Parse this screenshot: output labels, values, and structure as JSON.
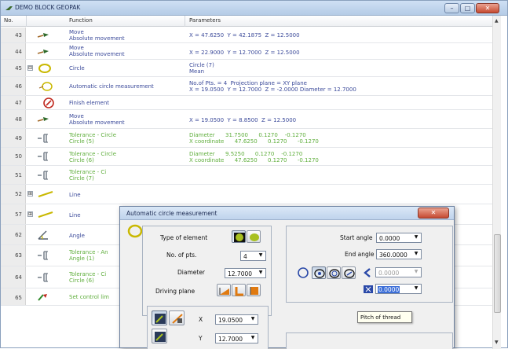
{
  "window": {
    "title": "DEMO BLOCK GEOPAK"
  },
  "columns": {
    "no": "No.",
    "function": "Function",
    "parameters": "Parameters"
  },
  "rows": [
    {
      "no": "43",
      "func1": "Move",
      "func2": "Absolute movement",
      "par1": "X = 47.6250  Y = 42.1875  Z = 12.5000",
      "par2": "",
      "icon": "move-icon"
    },
    {
      "no": "44",
      "func1": "Move",
      "func2": "Absolute movement",
      "par1": "X = 22.9000  Y = 12.7000  Z = 12.5000",
      "par2": "",
      "icon": "move-icon"
    },
    {
      "no": "45",
      "func1": "Circle",
      "func2": "",
      "par1": "Circle (7)",
      "par2": "Mean",
      "icon": "circle-icon"
    },
    {
      "no": "46",
      "func1": "Automatic circle measurement",
      "func2": "",
      "par1": "No.of Pts. = 4  Projection plane = XY plane",
      "par2": "X = 19.0500  Y = 12.7000  Z = -2.0000 Diameter = 12.7000",
      "icon": "circle-measure-icon"
    },
    {
      "no": "47",
      "func1": "Finish element",
      "func2": "",
      "par1": "",
      "par2": "",
      "icon": "finish-icon"
    },
    {
      "no": "48",
      "func1": "Move",
      "func2": "Absolute movement",
      "par1": "X = 19.0500  Y = 8.8500  Z = 12.5000",
      "par2": "",
      "icon": "move-icon"
    },
    {
      "no": "49",
      "func1": "Tolerance - Circle",
      "func2": "Circle (5)",
      "par1": "Diameter      31.7500      0.1270    -0.1270",
      "par2": "X coordinate      47.6250      0.1270      -0.1270",
      "icon": "tolerance-icon"
    },
    {
      "no": "50",
      "func1": "Tolerance - Circle",
      "func2": "Circle (6)",
      "par1": "Diameter      9.5250      0.1270    -0.1270",
      "par2": "X coordinate      47.6250      0.1270      -0.1270",
      "icon": "tolerance-icon"
    },
    {
      "no": "51",
      "func1": "Tolerance - Ci",
      "func2": "Circle (7)",
      "par1": "",
      "par2": "",
      "icon": "tolerance-icon"
    },
    {
      "no": "52",
      "func1": "Line",
      "func2": "",
      "par1": "",
      "par2": "",
      "icon": "line-icon"
    },
    {
      "no": "57",
      "func1": "Line",
      "func2": "",
      "par1": "",
      "par2": "",
      "icon": "line-icon"
    },
    {
      "no": "62",
      "func1": "Angle",
      "func2": "",
      "par1": "",
      "par2": "",
      "icon": "angle-icon"
    },
    {
      "no": "63",
      "func1": "Tolerance - An",
      "func2": "Angle (1)",
      "par1": "",
      "par2": "",
      "icon": "tolerance-icon"
    },
    {
      "no": "64",
      "func1": "Tolerance - Ci",
      "func2": "Circle (6)",
      "par1": "",
      "par2": "",
      "icon": "tolerance-icon"
    },
    {
      "no": "65",
      "func1": "Set control lim",
      "func2": "",
      "par1": "",
      "par2": "",
      "icon": "control-limit-icon"
    }
  ],
  "dialog": {
    "title": "Automatic circle measurement",
    "type_of_element_label": "Type of element",
    "no_of_pts_label": "No. of pts.",
    "no_of_pts_value": "4",
    "diameter_label": "Diameter",
    "diameter_value": "12.7000",
    "driving_plane_label": "Driving plane",
    "start_angle_label": "Start angle",
    "start_angle_value": "0.0000",
    "end_angle_label": "End angle",
    "end_angle_value": "360.0000",
    "pitch_disabled_value": "0.0000",
    "pitch_value": "0.0000",
    "tooltip": "Pitch of thread",
    "x_label": "X",
    "x_value": "19.0500",
    "y_label": "Y",
    "y_value": "12.7000"
  },
  "colors": {
    "row_text": "#3b4a9a",
    "tolerance_text": "#5fae3c",
    "title_gradient": "#b4cbe6"
  }
}
